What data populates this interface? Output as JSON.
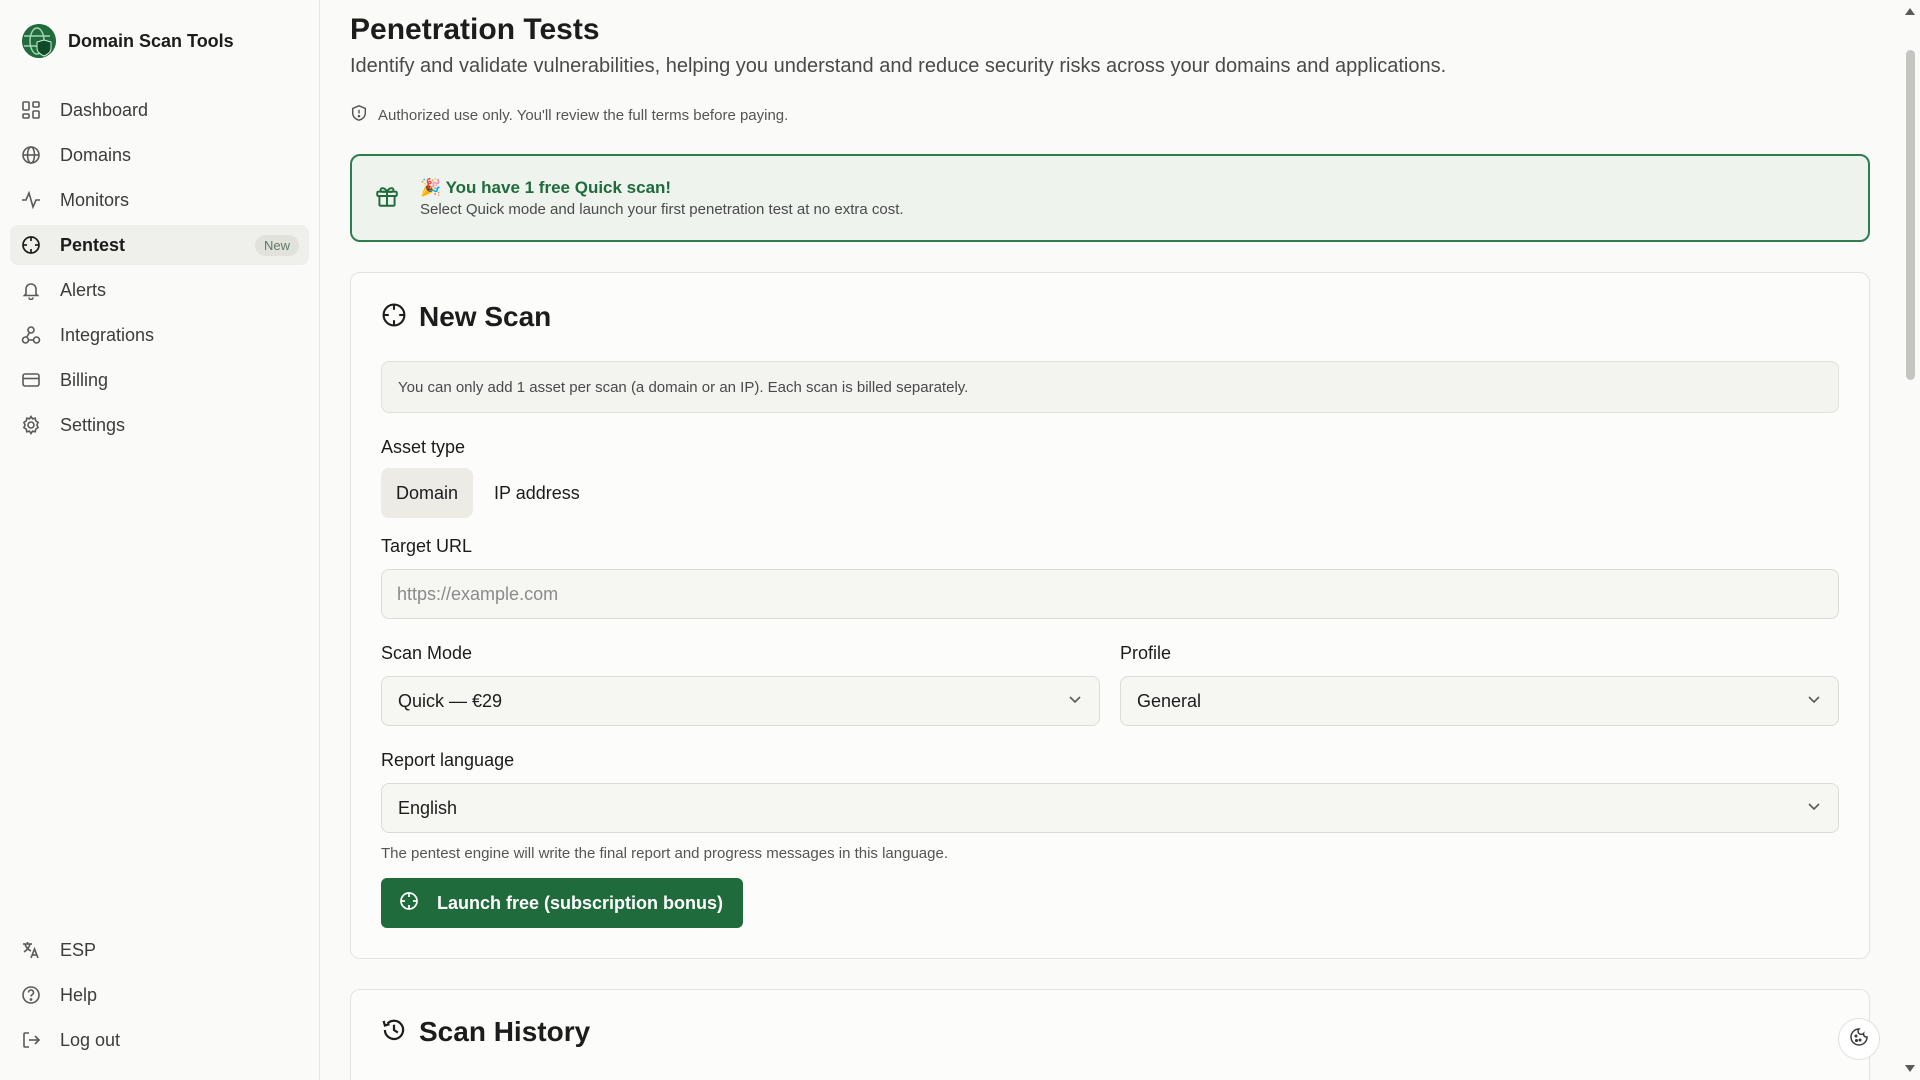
{
  "brand": {
    "title": "Domain Scan Tools",
    "logo": "globe-shield-logo"
  },
  "sidebar": {
    "items": [
      {
        "label": "Dashboard",
        "icon": "dashboard-icon"
      },
      {
        "label": "Domains",
        "icon": "globe-icon"
      },
      {
        "label": "Monitors",
        "icon": "activity-icon"
      },
      {
        "label": "Pentest",
        "icon": "crosshair-icon",
        "badge": "New",
        "active": true
      },
      {
        "label": "Alerts",
        "icon": "bell-icon"
      },
      {
        "label": "Integrations",
        "icon": "webhook-icon"
      },
      {
        "label": "Billing",
        "icon": "credit-card-icon"
      },
      {
        "label": "Settings",
        "icon": "gear-icon"
      }
    ],
    "bottom": [
      {
        "label": "ESP",
        "icon": "translate-icon"
      },
      {
        "label": "Help",
        "icon": "help-circle-icon"
      },
      {
        "label": "Log out",
        "icon": "log-out-icon"
      }
    ]
  },
  "header": {
    "title": "Penetration Tests",
    "subtitle": "Identify and validate vulnerabilities, helping you understand and reduce security risks across your domains and applications.",
    "auth_note": "Authorized use only. You'll review the full terms before paying."
  },
  "promo": {
    "emoji": "🎉",
    "title": "You have 1 free Quick scan!",
    "text": "Select Quick mode and launch your first penetration test at no extra cost."
  },
  "new_scan": {
    "title": "New Scan",
    "info": "You can only add 1 asset per scan (a domain or an IP). Each scan is billed separately.",
    "asset_type_label": "Asset type",
    "asset_types": [
      "Domain",
      "IP address"
    ],
    "target_label": "Target URL",
    "target_placeholder": "https://example.com",
    "scan_mode_label": "Scan Mode",
    "scan_mode_value": "Quick — €29",
    "profile_label": "Profile",
    "profile_value": "General",
    "language_label": "Report language",
    "language_value": "English",
    "language_hint": "The pentest engine will write the final report and progress messages in this language.",
    "launch_label": "Launch free (subscription bonus)"
  },
  "history": {
    "title": "Scan History"
  },
  "colors": {
    "accent": "#1f6b3c",
    "promo_bg": "#eef3ee",
    "background": "#fafaf8"
  }
}
